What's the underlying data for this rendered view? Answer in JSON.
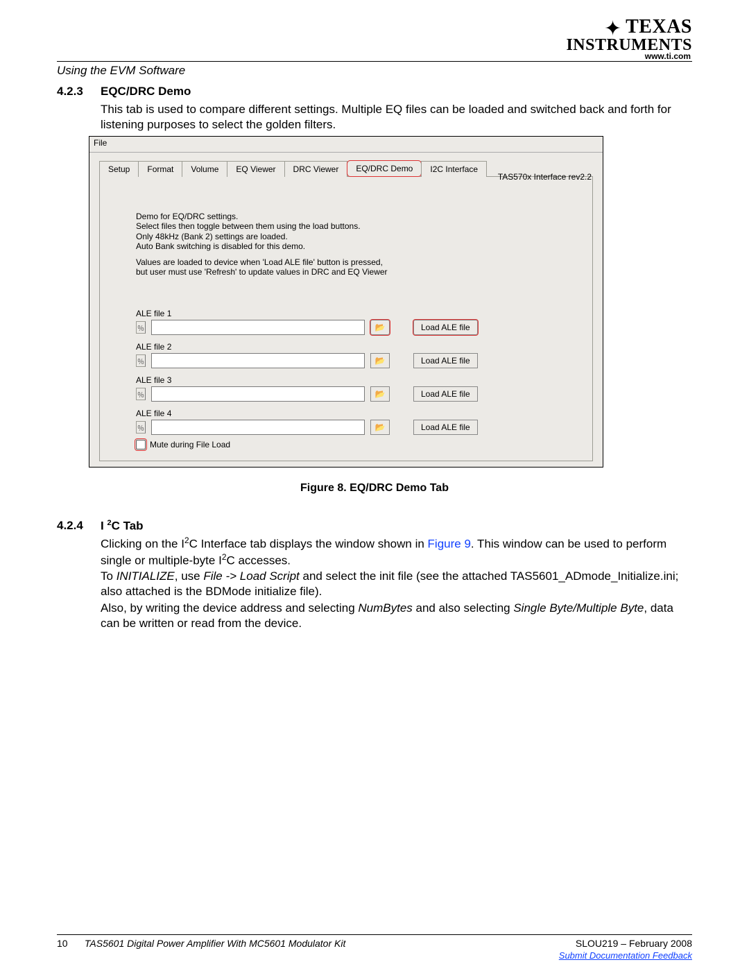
{
  "header": {
    "section_label": "Using the EVM Software",
    "ti_line1": "TEXAS",
    "ti_line2": "INSTRUMENTS",
    "url": "www.ti.com"
  },
  "section_423": {
    "num": "4.2.3",
    "title": "EQC/DRC Demo",
    "para": "This tab is used to compare different settings. Multiple EQ files can be loaded and switched back and forth for listening purposes to select the golden filters."
  },
  "screenshot": {
    "file_menu": "File",
    "tabs": [
      "Setup",
      "Format",
      "Volume",
      "EQ Viewer",
      "DRC Viewer",
      "EQ/DRC Demo",
      "I2C Interface"
    ],
    "active_tab_index": 5,
    "rev_label": "TAS570x Interface rev2.2",
    "desc_lines": [
      "Demo for EQ/DRC settings.",
      "Select files then toggle between them using the load buttons.",
      "Only 48kHz (Bank 2) settings are loaded.",
      "Auto Bank switching is disabled for this demo.",
      "",
      "Values are loaded to device when 'Load ALE file' button is pressed,",
      "but user must use 'Refresh' to update values in DRC and EQ Viewer"
    ],
    "files": [
      {
        "label": "ALE file 1",
        "value": "",
        "hl_browse": true,
        "hl_load": true
      },
      {
        "label": "ALE file 2",
        "value": "",
        "hl_browse": false,
        "hl_load": false
      },
      {
        "label": "ALE file 3",
        "value": "",
        "hl_browse": false,
        "hl_load": false
      },
      {
        "label": "ALE file 4",
        "value": "",
        "hl_browse": false,
        "hl_load": false
      }
    ],
    "load_btn_label": "Load ALE file",
    "mute_label": "Mute during File Load"
  },
  "figure_caption": "Figure 8. EQ/DRC Demo Tab",
  "section_424": {
    "num": "4.2.4",
    "title_prefix": "I ",
    "title_sup": "2",
    "title_suffix": "C Tab",
    "para1_a": "Clicking on the I",
    "para1_b": "C Interface tab displays the window shown in ",
    "para1_link": "Figure 9",
    "para1_c": ". This window can be used to perform single or multiple-byte I",
    "para1_d": "C accesses.",
    "para2_a": "To ",
    "para2_i1": "INITIALIZE",
    "para2_b": ", use ",
    "para2_i2": "File -> Load Script",
    "para2_c": " and select the init file (see the attached TAS5601_ADmode_Initialize.ini; also attached is the BDMode initialize file).",
    "para3_a": "Also, by writing the device address and selecting ",
    "para3_i1": "NumBytes",
    "para3_b": " and also selecting ",
    "para3_i2": "Single Byte/Multiple Byte",
    "para3_c": ", data can be written or read from the device."
  },
  "footer": {
    "page": "10",
    "title": "TAS5601 Digital Power Amplifier With MC5601 Modulator Kit",
    "right": "SLOU219 – February 2008",
    "link": "Submit Documentation Feedback"
  }
}
